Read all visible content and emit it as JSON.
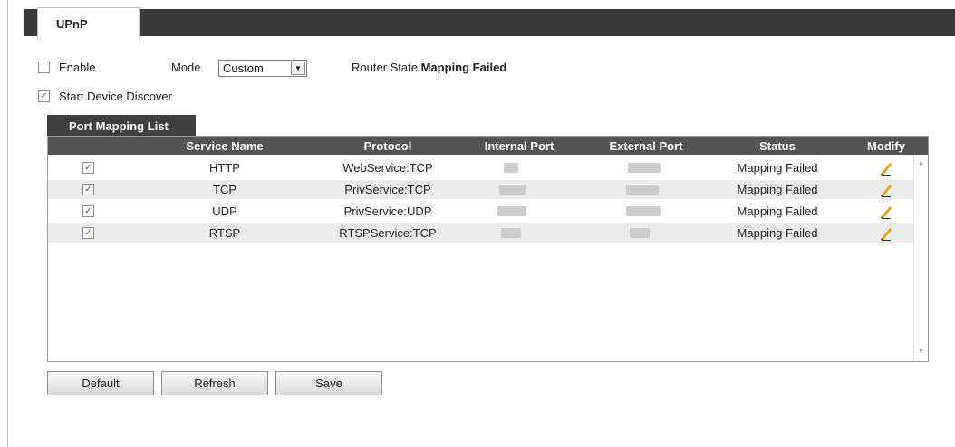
{
  "tabs": {
    "active": "UPnP"
  },
  "options": {
    "enable_label": "Enable",
    "enable_checked": false,
    "mode_label": "Mode",
    "mode_value": "Custom",
    "router_state_label": "Router State",
    "router_state_value": "Mapping Failed",
    "discover_label": "Start Device Discover",
    "discover_checked": true
  },
  "port_mapping": {
    "tab_label": "Port Mapping List",
    "columns": [
      "Service Name",
      "Protocol",
      "Internal Port",
      "External Port",
      "Status",
      "Modify"
    ],
    "rows": [
      {
        "checked": true,
        "service": "HTTP",
        "protocol": "WebService:TCP",
        "status": "Mapping Failed"
      },
      {
        "checked": true,
        "service": "TCP",
        "protocol": "PrivService:TCP",
        "status": "Mapping Failed"
      },
      {
        "checked": true,
        "service": "UDP",
        "protocol": "PrivService:UDP",
        "status": "Mapping Failed"
      },
      {
        "checked": true,
        "service": "RTSP",
        "protocol": "RTSPService:TCP",
        "status": "Mapping Failed"
      }
    ]
  },
  "buttons": {
    "default": "Default",
    "refresh": "Refresh",
    "save": "Save"
  },
  "icons": {
    "modify": "pencil-icon",
    "scroll_up": "scroll-up-icon",
    "scroll_down": "scroll-down-icon"
  },
  "colors": {
    "header_bg": "#545454",
    "tab_strip_bg": "#3a3a3a",
    "row_alt_bg": "#ebebeb",
    "pencil": "#e8a317"
  }
}
